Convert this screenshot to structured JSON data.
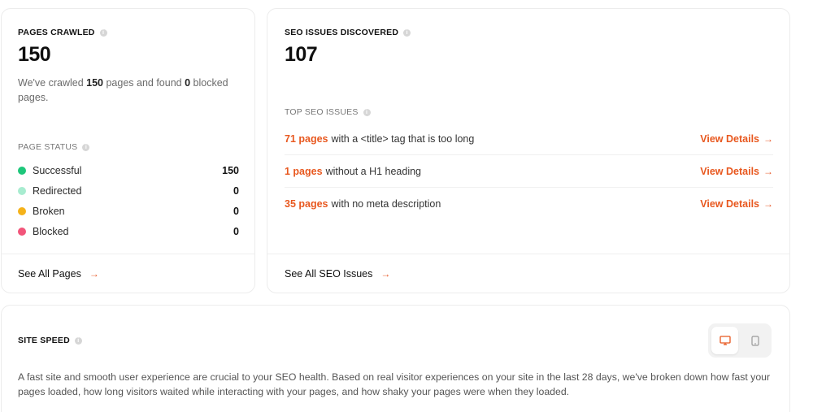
{
  "pages_crawled": {
    "title": "PAGES CRAWLED",
    "count": "150",
    "desc_prefix": "We've crawled ",
    "desc_pages": "150",
    "desc_middle": " pages and found ",
    "desc_blocked": "0",
    "desc_suffix": " blocked pages.",
    "status_title": "PAGE STATUS",
    "statuses": [
      {
        "label": "Successful",
        "count": "150",
        "color": "#1ec77b"
      },
      {
        "label": "Redirected",
        "count": "0",
        "color": "#a8ecd0"
      },
      {
        "label": "Broken",
        "count": "0",
        "color": "#f5b21a"
      },
      {
        "label": "Blocked",
        "count": "0",
        "color": "#f2557a"
      }
    ],
    "footer_link": "See All Pages"
  },
  "seo_issues": {
    "title": "SEO ISSUES DISCOVERED",
    "count": "107",
    "top_title": "TOP SEO ISSUES",
    "issues": [
      {
        "count": "71 pages",
        "text": "with a <title> tag that is too long",
        "link": "View Details"
      },
      {
        "count": "1 pages",
        "text": "without a H1 heading",
        "link": "View Details"
      },
      {
        "count": "35 pages",
        "text": "with no meta description",
        "link": "View Details"
      }
    ],
    "footer_link": "See All SEO Issues"
  },
  "site_speed": {
    "title": "SITE SPEED",
    "description": "A fast site and smooth user experience are crucial to your SEO health. Based on real visitor experiences on your site in the last 28 days, we've broken down how fast your pages loaded, how long visitors waited while interacting with your pages, and how shaky your pages were when they loaded.",
    "device_toggle": {
      "active": "desktop-icon",
      "inactive": "mobile-icon"
    }
  },
  "colors": {
    "accent": "#e8581f"
  }
}
